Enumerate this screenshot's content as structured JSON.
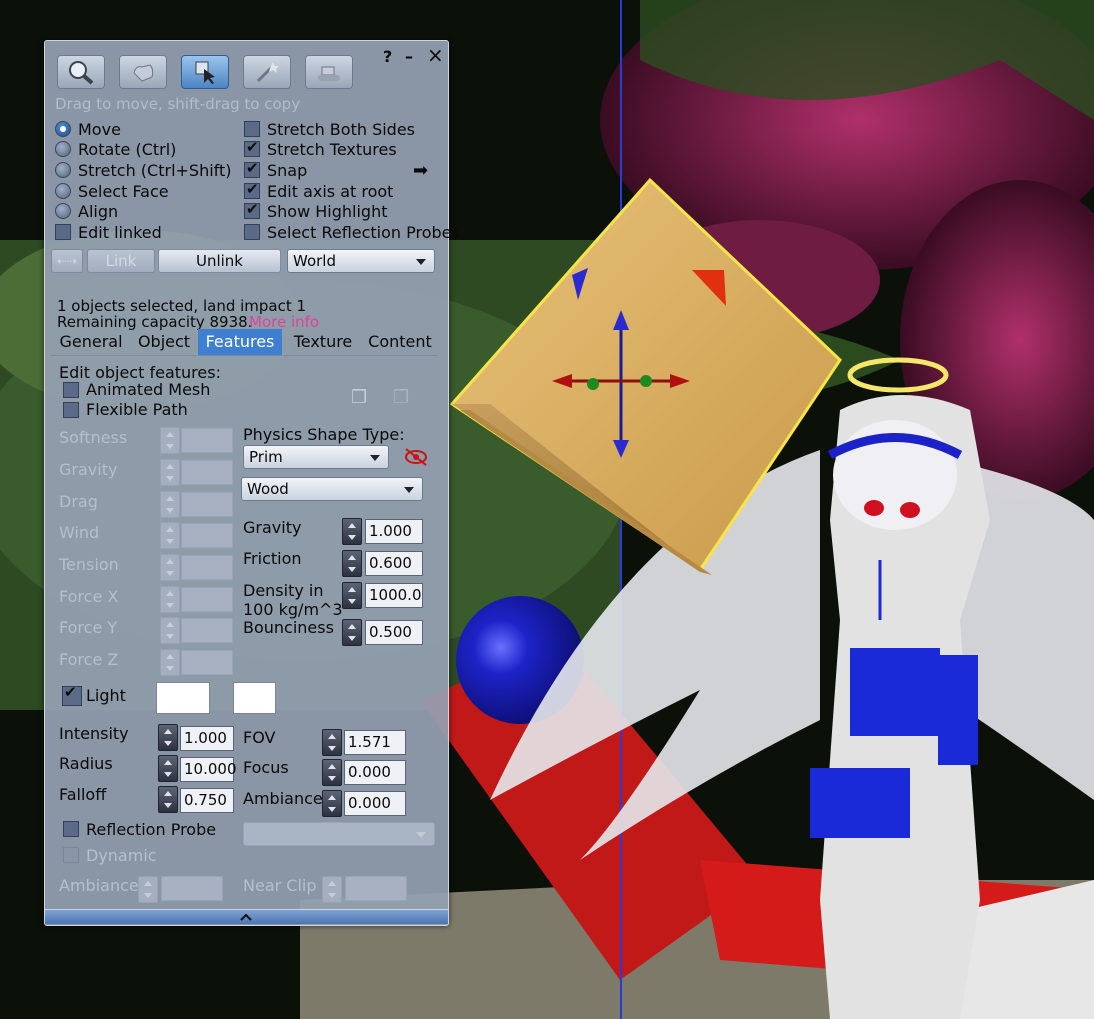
{
  "window": {
    "help": "?",
    "minimize": "–",
    "close": "×"
  },
  "toolbar": {
    "hint": "Drag to move, shift-drag to copy",
    "tools": [
      "focus-tool",
      "move-tool",
      "edit-tool",
      "create-tool",
      "land-tool"
    ]
  },
  "modes": {
    "move": "Move",
    "rotate": "Rotate (Ctrl)",
    "stretch": "Stretch (Ctrl+Shift)",
    "select_face": "Select Face",
    "align": "Align",
    "edit_linked": "Edit linked"
  },
  "options": {
    "stretch_both_sides": "Stretch Both Sides",
    "stretch_textures": "Stretch Textures",
    "snap": "Snap",
    "edit_axis_at_root": "Edit axis at root",
    "show_highlight": "Show Highlight",
    "select_reflection_probes": "Select Reflection Probes"
  },
  "link_row": {
    "link": "Link",
    "unlink": "Unlink",
    "ruler": "World"
  },
  "selection": {
    "line1": "1 objects selected, land impact 1",
    "line2": "Remaining capacity 8938.",
    "more_info": "More info"
  },
  "tabs": {
    "general": "General",
    "object": "Object",
    "features": "Features",
    "texture": "Texture",
    "content": "Content"
  },
  "features": {
    "heading": "Edit object features:",
    "animated_mesh": "Animated Mesh",
    "flexible_path": "Flexible Path",
    "flex_labels": {
      "softness": "Softness",
      "gravity": "Gravity",
      "drag": "Drag",
      "wind": "Wind",
      "tension": "Tension",
      "force_x": "Force X",
      "force_y": "Force Y",
      "force_z": "Force Z"
    },
    "physics": {
      "shape_type_label": "Physics Shape Type:",
      "shape_type": "Prim",
      "material": "Wood",
      "gravity_label": "Gravity",
      "gravity": "1.000",
      "friction_label": "Friction",
      "friction": "0.600",
      "density_label_1": "Density in",
      "density_label_2": "100 kg/m^3",
      "density": "1000.0",
      "bounciness_label": "Bounciness",
      "bounciness": "0.500"
    },
    "light": {
      "label": "Light",
      "intensity_label": "Intensity",
      "intensity": "1.000",
      "radius_label": "Radius",
      "radius": "10.000",
      "falloff_label": "Falloff",
      "falloff": "0.750",
      "fov_label": "FOV",
      "fov": "1.571",
      "focus_label": "Focus",
      "focus": "0.000",
      "ambiance_label": "Ambiance",
      "ambiance": "0.000"
    },
    "reflection_probe": {
      "label": "Reflection Probe",
      "dynamic": "Dynamic",
      "ambiance_label": "Ambiance",
      "near_clip_label": "Near Clip"
    }
  },
  "colors": {
    "accent": "#3f7fd2",
    "more_info_link": "#e0409a",
    "panel": "#94a0b2"
  }
}
